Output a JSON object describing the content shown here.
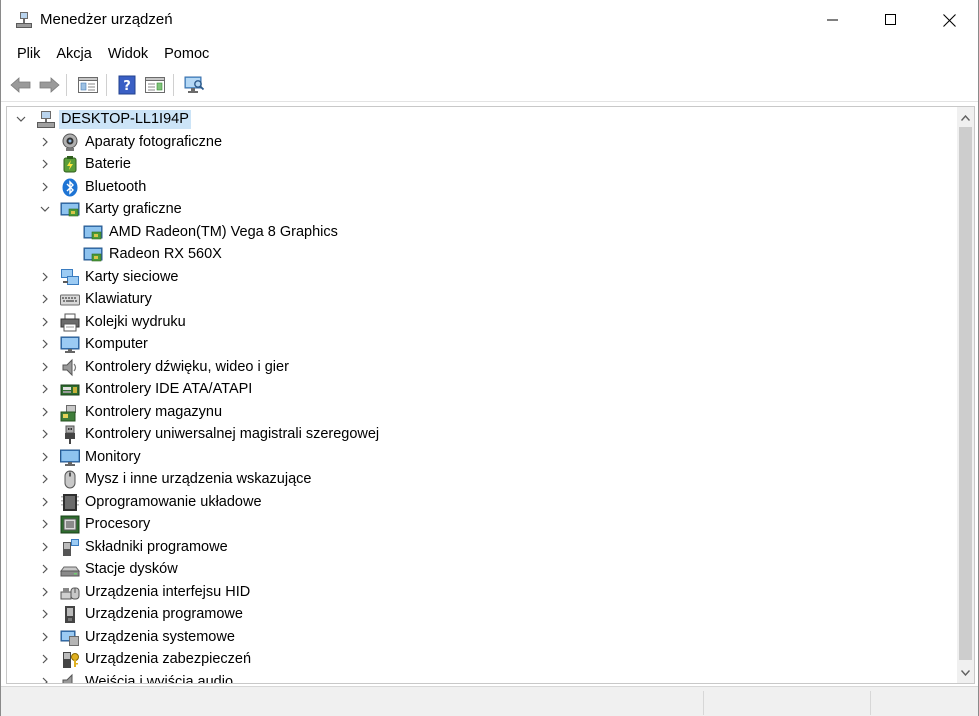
{
  "window": {
    "title": "Menedżer urządzeń"
  },
  "menu": [
    "Plik",
    "Akcja",
    "Widok",
    "Pomoc"
  ],
  "toolbar": {
    "icons": [
      "back-arrow-icon",
      "forward-arrow-icon",
      "properties-icon",
      "help-icon",
      "view-toggle-icon",
      "scan-hardware-icon"
    ]
  },
  "tree": {
    "root": "DESKTOP-LL1I94P",
    "categories": [
      {
        "label": "Aparaty fotograficzne",
        "icon": "camera-icon",
        "expanded": false
      },
      {
        "label": "Baterie",
        "icon": "battery-icon",
        "expanded": false
      },
      {
        "label": "Bluetooth",
        "icon": "bluetooth-icon",
        "expanded": false
      },
      {
        "label": "Karty graficzne",
        "icon": "display-adapter-icon",
        "expanded": true,
        "children": [
          "AMD Radeon(TM) Vega 8 Graphics",
          "Radeon RX 560X"
        ]
      },
      {
        "label": "Karty sieciowe",
        "icon": "network-adapter-icon",
        "expanded": false
      },
      {
        "label": "Klawiatury",
        "icon": "keyboard-icon",
        "expanded": false
      },
      {
        "label": "Kolejki wydruku",
        "icon": "printer-icon",
        "expanded": false
      },
      {
        "label": "Komputer",
        "icon": "computer-icon",
        "expanded": false
      },
      {
        "label": "Kontrolery dźwięku, wideo i gier",
        "icon": "speaker-icon",
        "expanded": false
      },
      {
        "label": "Kontrolery IDE ATA/ATAPI",
        "icon": "ide-controller-icon",
        "expanded": false
      },
      {
        "label": "Kontrolery magazynu",
        "icon": "storage-controller-icon",
        "expanded": false
      },
      {
        "label": "Kontrolery uniwersalnej magistrali szeregowej",
        "icon": "usb-icon",
        "expanded": false
      },
      {
        "label": "Monitory",
        "icon": "monitor-icon",
        "expanded": false
      },
      {
        "label": "Mysz i inne urządzenia wskazujące",
        "icon": "mouse-icon",
        "expanded": false
      },
      {
        "label": "Oprogramowanie układowe",
        "icon": "firmware-icon",
        "expanded": false
      },
      {
        "label": "Procesory",
        "icon": "processor-icon",
        "expanded": false
      },
      {
        "label": "Składniki programowe",
        "icon": "software-component-icon",
        "expanded": false
      },
      {
        "label": "Stacje dysków",
        "icon": "disk-drive-icon",
        "expanded": false
      },
      {
        "label": "Urządzenia interfejsu HID",
        "icon": "hid-icon",
        "expanded": false
      },
      {
        "label": "Urządzenia programowe",
        "icon": "software-device-icon",
        "expanded": false
      },
      {
        "label": "Urządzenia systemowe",
        "icon": "system-device-icon",
        "expanded": false
      },
      {
        "label": "Urządzenia zabezpieczeń",
        "icon": "security-device-icon",
        "expanded": false
      },
      {
        "label": "Wejścia i wyjścia audio",
        "icon": "audio-io-icon",
        "expanded": false
      }
    ]
  },
  "colors": {
    "selection": "#cce4f7",
    "accent": "#0078d7"
  }
}
